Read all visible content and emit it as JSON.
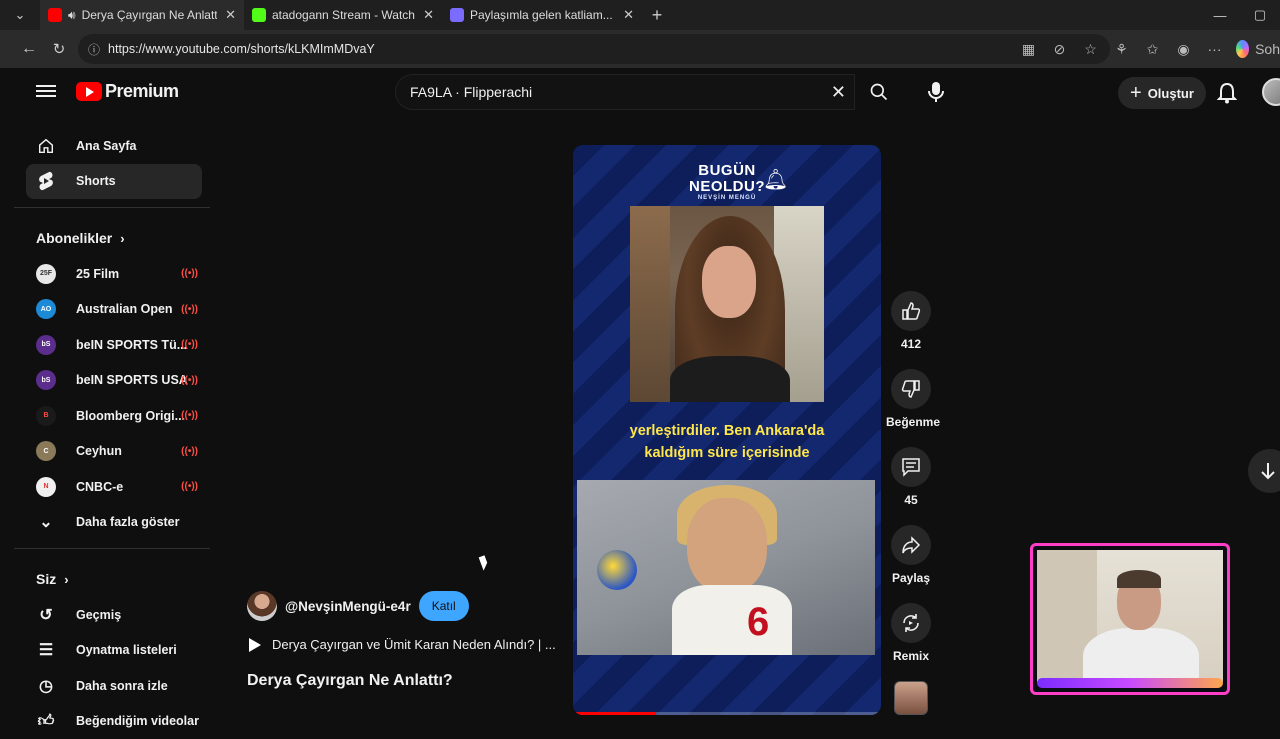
{
  "browser": {
    "tabs": [
      {
        "title": "Derya Çayırgan Ne Anlattı? - Y",
        "favicon_color": "#ff0000",
        "active": true
      },
      {
        "title": "atadogann Stream - Watch Live or",
        "favicon_color": "#53fc18",
        "active": false
      },
      {
        "title": "Paylaşımla gelen katliam... Ada ile",
        "favicon_color": "#7b6cff",
        "active": false
      }
    ],
    "url": "https://www.youtube.com/shorts/kLKMImMDvaY",
    "copilot_label": "Soh"
  },
  "header": {
    "brand": "Premium",
    "search_value": "FA9LA · Flipperachi",
    "create_label": "Oluştur"
  },
  "sidebar": {
    "main": [
      {
        "label": "Ana Sayfa",
        "icon": "home-icon"
      },
      {
        "label": "Shorts",
        "icon": "shorts-icon"
      }
    ],
    "subscriptions_title": "Abonelikler",
    "channels": [
      {
        "label": "25 Film",
        "avatar_color": "#e8e8e8",
        "avatar_text": "25F",
        "live": true
      },
      {
        "label": "Australian Open",
        "avatar_color": "#1c8ad6",
        "avatar_text": "AO",
        "live": true
      },
      {
        "label": "beIN SPORTS Tü...",
        "avatar_color": "#5b2d8c",
        "avatar_text": "bS",
        "live": true
      },
      {
        "label": "beIN SPORTS USA",
        "avatar_color": "#5b2d8c",
        "avatar_text": "bS",
        "live": true
      },
      {
        "label": "Bloomberg Origi...",
        "avatar_color": "#1a1a1a",
        "avatar_text": "B",
        "live": true
      },
      {
        "label": "Ceyhun",
        "avatar_color": "#8a7a5a",
        "avatar_text": "C",
        "live": true
      },
      {
        "label": "CNBC-e",
        "avatar_color": "#f0f0f0",
        "avatar_text": "N",
        "live": true
      }
    ],
    "show_more": "Daha fazla göster",
    "you_title": "Siz",
    "you_items": [
      {
        "label": "Geçmiş",
        "icon": "history-icon"
      },
      {
        "label": "Oynatma listeleri",
        "icon": "playlists-icon"
      },
      {
        "label": "Daha sonra izle",
        "icon": "clock-icon"
      },
      {
        "label": "Beğendiğim videolar",
        "icon": "like-icon"
      }
    ]
  },
  "short": {
    "brand_line1": "BUGÜN",
    "brand_line2": "NEOLDU?",
    "brand_sub": "NEVŞİN MENGÜ",
    "subtitle_line1": "yerleştirdiler. Ben Ankara'da",
    "subtitle_line2": "kaldığım süre içerisinde",
    "jersey_number": "6",
    "progress": 0.27
  },
  "actions": {
    "likes": "412",
    "dislike_label": "Beğenme",
    "comments": "45",
    "share_label": "Paylaş",
    "remix_label": "Remix"
  },
  "channel": {
    "handle": "@NevşinMengü-e4r",
    "join_label": "Katıl",
    "playlist_title": "Derya Çayırgan ve Ümit Karan Neden Alındı? | ...",
    "title": "Derya Çayırgan Ne Anlattı?"
  }
}
